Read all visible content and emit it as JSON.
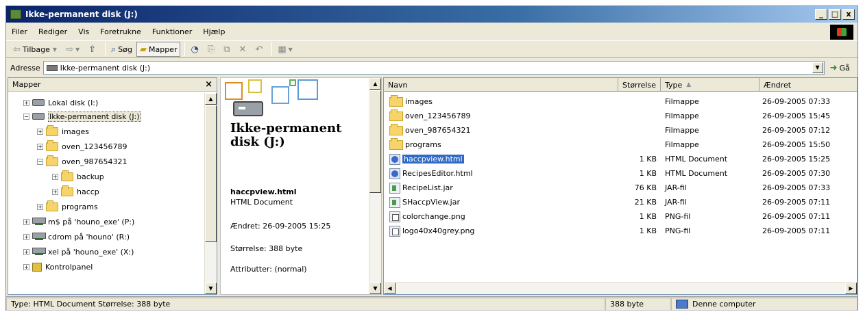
{
  "window": {
    "title": "Ikke-permanent disk (J:)",
    "buttons": {
      "minimize": "_",
      "maximize": "□",
      "close": "x"
    }
  },
  "menu": [
    "Filer",
    "Rediger",
    "Vis",
    "Foretrukne",
    "Funktioner",
    "Hjælp"
  ],
  "toolbar": {
    "back": "Tilbage",
    "search": "Søg",
    "folders": "Mapper"
  },
  "address": {
    "label": "Adresse",
    "value": "Ikke-permanent disk (J:)",
    "go": "Gå"
  },
  "folder_pane": {
    "title": "Mapper",
    "close": "×",
    "items": [
      {
        "label": "Lokal disk (I:)",
        "icon": "disk-icon",
        "expander": "+"
      },
      {
        "label": "Ikke-permanent disk (J:)",
        "icon": "disk-icon",
        "expander": "−",
        "selected": true
      },
      {
        "label": "images",
        "icon": "folder-icon",
        "expander": "+"
      },
      {
        "label": "oven_123456789",
        "icon": "folder-icon",
        "expander": "+"
      },
      {
        "label": "oven_987654321",
        "icon": "folder-icon",
        "expander": "−"
      },
      {
        "label": "backup",
        "icon": "folder-icon",
        "expander": "+"
      },
      {
        "label": "haccp",
        "icon": "folder-icon",
        "expander": "+"
      },
      {
        "label": "programs",
        "icon": "folder-icon",
        "expander": "+"
      },
      {
        "label": "m$ på 'houno_exe' (P:)",
        "icon": "network-drive-icon",
        "expander": "+"
      },
      {
        "label": "cdrom på 'houno' (R:)",
        "icon": "network-drive-icon",
        "expander": "+"
      },
      {
        "label": "xel på 'houno_exe' (X:)",
        "icon": "network-drive-icon",
        "expander": "+"
      },
      {
        "label": "Kontrolpanel",
        "icon": "control-panel-icon",
        "expander": "+"
      }
    ]
  },
  "details": {
    "title": "Ikke-permanent disk (J:)",
    "file_name": "haccpview.html",
    "file_type": "HTML Document",
    "modified": "Ændret: 26-09-2005 15:25",
    "size": "Størrelse: 388 byte",
    "attributes": "Attributter: (normal)"
  },
  "file_list": {
    "columns": {
      "name": "Navn",
      "size": "Størrelse",
      "type": "Type",
      "modified": "Ændret"
    },
    "rows": [
      {
        "name": "images",
        "size": "",
        "type": "Filmappe",
        "modified": "26-09-2005 07:33",
        "icon": "folder-icon"
      },
      {
        "name": "oven_123456789",
        "size": "",
        "type": "Filmappe",
        "modified": "26-09-2005 15:45",
        "icon": "folder-icon"
      },
      {
        "name": "oven_987654321",
        "size": "",
        "type": "Filmappe",
        "modified": "26-09-2005 07:12",
        "icon": "folder-icon"
      },
      {
        "name": "programs",
        "size": "",
        "type": "Filmappe",
        "modified": "26-09-2005 15:50",
        "icon": "folder-icon"
      },
      {
        "name": "haccpview.html",
        "size": "1 KB",
        "type": "HTML Document",
        "modified": "26-09-2005 15:25",
        "icon": "html-file-icon",
        "selected": true
      },
      {
        "name": "RecipesEditor.html",
        "size": "1 KB",
        "type": "HTML Document",
        "modified": "26-09-2005 07:30",
        "icon": "html-file-icon"
      },
      {
        "name": "RecipeList.jar",
        "size": "76 KB",
        "type": "JAR-fil",
        "modified": "26-09-2005 07:33",
        "icon": "jar-file-icon"
      },
      {
        "name": "SHaccpView.jar",
        "size": "21 KB",
        "type": "JAR-fil",
        "modified": "26-09-2005 07:11",
        "icon": "jar-file-icon"
      },
      {
        "name": "colorchange.png",
        "size": "1 KB",
        "type": "PNG-fil",
        "modified": "26-09-2005 07:11",
        "icon": "png-file-icon"
      },
      {
        "name": "logo40x40grey.png",
        "size": "1 KB",
        "type": "PNG-fil",
        "modified": "26-09-2005 07:11",
        "icon": "png-file-icon"
      }
    ]
  },
  "status": {
    "info": "Type: HTML Document Størrelse: 388 byte",
    "size": "388 byte",
    "zone": "Denne computer"
  },
  "colors": {
    "selection": "#316ac5",
    "title_start": "#0a246a",
    "title_end": "#a6caf0"
  }
}
